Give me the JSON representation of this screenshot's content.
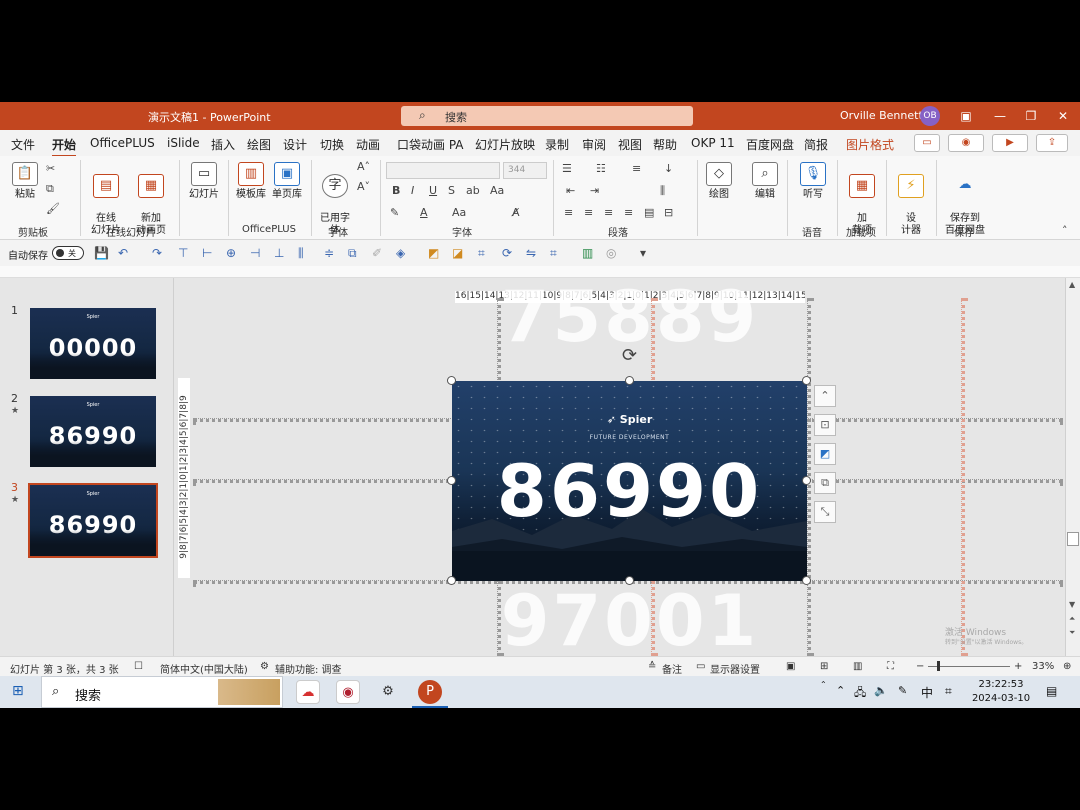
{
  "window": {
    "title": "演示文稿1 - PowerPoint",
    "search_placeholder": "搜索",
    "user": "Orville Bennett",
    "avatar_initials": "OB",
    "accent": "#c2461f"
  },
  "menu": {
    "tabs": [
      "文件",
      "开始",
      "OfficePLUS",
      "iSlide",
      "插入",
      "绘图",
      "设计",
      "切换",
      "动画",
      "口袋动画 PA",
      "幻灯片放映",
      "录制",
      "审阅",
      "视图",
      "帮助",
      "OKP 11",
      "百度网盘",
      "简报",
      "图片格式"
    ],
    "active_tab": "开始"
  },
  "ribbon": {
    "paste": "粘贴",
    "clipboard_group": "剪贴板",
    "online_slides": "在线\n幻灯片",
    "new_anim_page": "新加\n动画页",
    "online_slides_group": "在线幻灯片",
    "slides": "幻灯片",
    "template_lib": "模板库",
    "single_page_lib": "单页库",
    "officeplus_group": "OfficePLUS",
    "used_fonts": "已用字\n体",
    "font_group_small": "字体",
    "font_size": "344",
    "font_group": "字体",
    "paragraph_group": "段落",
    "drawing": "绘图",
    "editing": "编辑",
    "dictate": "听写",
    "voice_group": "语音",
    "addins": "加\n载项",
    "addins_group": "加载项",
    "designer": "设\n计器",
    "save_baidu": "保存到\n百度网盘",
    "save_group": "保存"
  },
  "qat": {
    "autosave_label": "自动保存",
    "autosave_state": "关"
  },
  "thumbnails": [
    {
      "num": "1",
      "number": "00000",
      "star": false
    },
    {
      "num": "2",
      "number": "86990",
      "star": true
    },
    {
      "num": "3",
      "number": "86990",
      "star": true
    }
  ],
  "selected_slide": 3,
  "ruler": {
    "horizontal": "16|15|14|13|12|11|10|9|8|7|6|5|4|3|2|1|0|1|2|3|4|5|6|7|8|9|10|11|12|13|14|15|16",
    "vertical": "9|8|7|6|5|4|3|2|1|0|1|2|3|4|5|6|7|8|9"
  },
  "slide": {
    "logo": "Spier",
    "subtitle": "FUTURE DEVELOPMENT",
    "number": "86990",
    "prev_number": "75889",
    "next_number": "97001"
  },
  "watermark": {
    "line1": "激活 Windows",
    "line2": "转到\"设置\"以激活 Windows。"
  },
  "status": {
    "slide_info": "幻灯片 第 3 张，共 3 张",
    "language": "简体中文(中国大陆)",
    "accessibility": "辅助功能: 调查",
    "notes": "备注",
    "display_settings": "显示器设置",
    "zoom": "33%"
  },
  "taskbar": {
    "search": "搜索",
    "time": "23:22:53",
    "date": "2024-03-10",
    "ime": "中"
  }
}
